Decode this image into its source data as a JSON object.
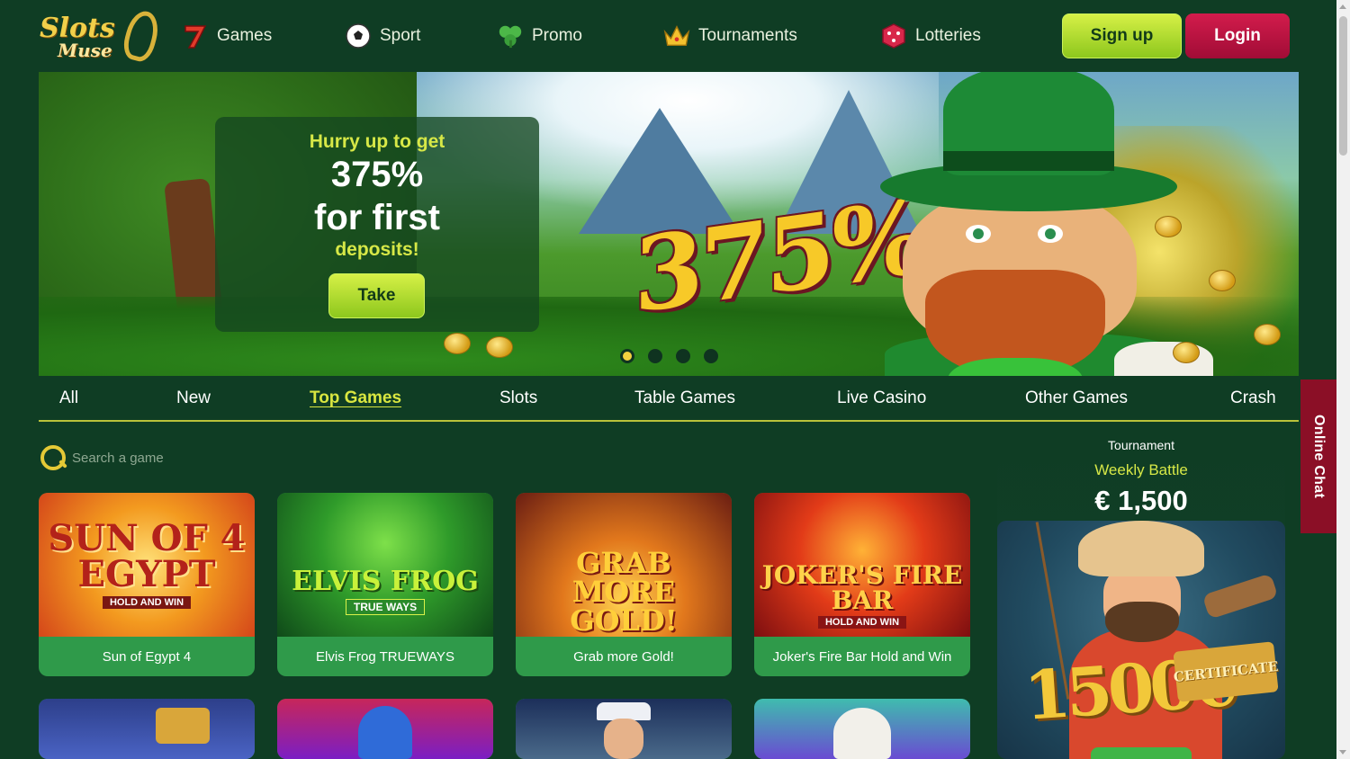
{
  "header": {
    "logo": {
      "line1": "Slots",
      "line2": "Muse"
    },
    "nav": [
      {
        "label": "Games",
        "icon": "lucky-seven-icon"
      },
      {
        "label": "Sport",
        "icon": "soccer-ball-icon"
      },
      {
        "label": "Promo",
        "icon": "clover-icon"
      },
      {
        "label": "Tournaments",
        "icon": "crown-icon"
      },
      {
        "label": "Lotteries",
        "icon": "dice-icon"
      }
    ],
    "signup_label": "Sign up",
    "login_label": "Login"
  },
  "banner": {
    "promo_line1": "Hurry up to get",
    "promo_line2": "375%",
    "promo_line3": "for first",
    "promo_line4": "deposits!",
    "cta_label": "Take",
    "big_percent": "375%",
    "slides_total": 4,
    "active_slide": 1
  },
  "categories": {
    "tabs": [
      "All",
      "New",
      "Top Games",
      "Slots",
      "Table Games",
      "Live Casino",
      "Other Games",
      "Crash"
    ],
    "active": "Top Games"
  },
  "search": {
    "placeholder": "Search a game"
  },
  "games": [
    {
      "title": "Sun of Egypt 4",
      "art_text": "SUN OF 4 EGYPT",
      "art_sub": "HOLD AND WIN"
    },
    {
      "title": "Elvis Frog TRUEWAYS",
      "art_text": "ELVIS FROG",
      "art_sub": "TRUE WAYS"
    },
    {
      "title": "Grab more Gold!",
      "art_text": "GRAB MORE GOLD!",
      "art_sub": ""
    },
    {
      "title": "Joker's Fire Bar Hold and Win",
      "art_text": "JOKER'S FIRE BAR",
      "art_sub": "HOLD AND WIN"
    }
  ],
  "tournament": {
    "label": "Tournament",
    "name": "Weekly Battle",
    "prize": "€ 1,500",
    "art_prize": "1500€",
    "art_cert": "CERTIFICATE"
  },
  "online_chat_label": "Online Chat",
  "colors": {
    "background": "#0f3d24",
    "accent_green": "#8dc71d",
    "accent_yellow": "#d7e847",
    "login_red": "#c0143f",
    "card_green": "#2f9a4a"
  }
}
